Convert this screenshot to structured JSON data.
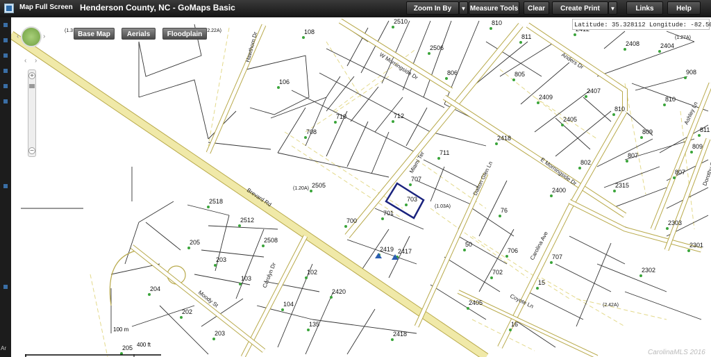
{
  "toolbar": {
    "fullscreen_label": "Map Full Screen",
    "title": "Henderson County, NC - GoMaps Basic",
    "zoom_box_label": "Zoom In By Box",
    "measure_label": "Measure Tools",
    "clear_label": "Clear",
    "print_label": "Create Print Map",
    "links_label": "Links",
    "help_label": "Help",
    "dropdown_glyph": "▼"
  },
  "coords": {
    "text": "Latitude: 35.328112   Longitude: -82.505631"
  },
  "layers": {
    "basemap": "Base Map",
    "aerials": "Aerials",
    "floodplain": "Floodplain"
  },
  "zoom": {
    "in": "+",
    "out": "−",
    "level_fraction": 0.12
  },
  "scale": {
    "small": "100 m",
    "large": "400 ft"
  },
  "watermark": "CarolinaMLS 2016",
  "left_strip_text": "Ar",
  "streets": [
    {
      "name": "Brevard Rd"
    },
    {
      "name": "W Morningside Dr"
    },
    {
      "name": "Hawthorn Dr"
    },
    {
      "name": "Miami Ter"
    },
    {
      "name": "Dalton Glen Ln"
    },
    {
      "name": "E Morningside Dr"
    },
    {
      "name": "Anders Dr"
    },
    {
      "name": "Carolina Ave"
    },
    {
      "name": "Coyote Ln"
    },
    {
      "name": "Carolyn Dr"
    },
    {
      "name": "Moody St"
    },
    {
      "name": "Ashley Ln"
    },
    {
      "name": "Dorothy St"
    }
  ],
  "parcels": [
    "108",
    "2510",
    "810",
    "811",
    "2412",
    "2408",
    "2404",
    "2506",
    "806",
    "805",
    "908",
    "106",
    "2409",
    "2407",
    "810",
    "810",
    "712",
    "710",
    "708",
    "2405",
    "809",
    "811",
    "711",
    "2418",
    "802",
    "809",
    "807",
    "807",
    "707",
    "2505",
    "2518",
    "2400",
    "2315",
    "703",
    "(1.03A)",
    "701",
    "700",
    "2512",
    "2508",
    "76",
    "2303",
    "205",
    "203",
    "2419",
    "2417",
    "50",
    "706",
    "707",
    "2301",
    "102",
    "103",
    "702",
    "2302",
    "204",
    "2420",
    "15",
    "202",
    "104",
    "2405",
    "135",
    "16",
    "203",
    "2418",
    "205",
    "(2.42A)",
    "(1.27A)",
    "(2.22A)",
    "(1.20A)"
  ],
  "acreage_labels": [
    {
      "text": "(2.22A)"
    },
    {
      "text": "(1.27A)"
    },
    {
      "text": "(1.20A)"
    },
    {
      "text": "(1.03A)"
    },
    {
      "text": "(2.42A)"
    }
  ],
  "colors": {
    "road": "#f0e9a8",
    "road_edge": "#b8a94a",
    "parcel_line": "#333333",
    "dashed_line": "#e3d98a",
    "lot_point": "#3aa53a",
    "highlight": "#1a237e",
    "toolbar": "#222222"
  }
}
